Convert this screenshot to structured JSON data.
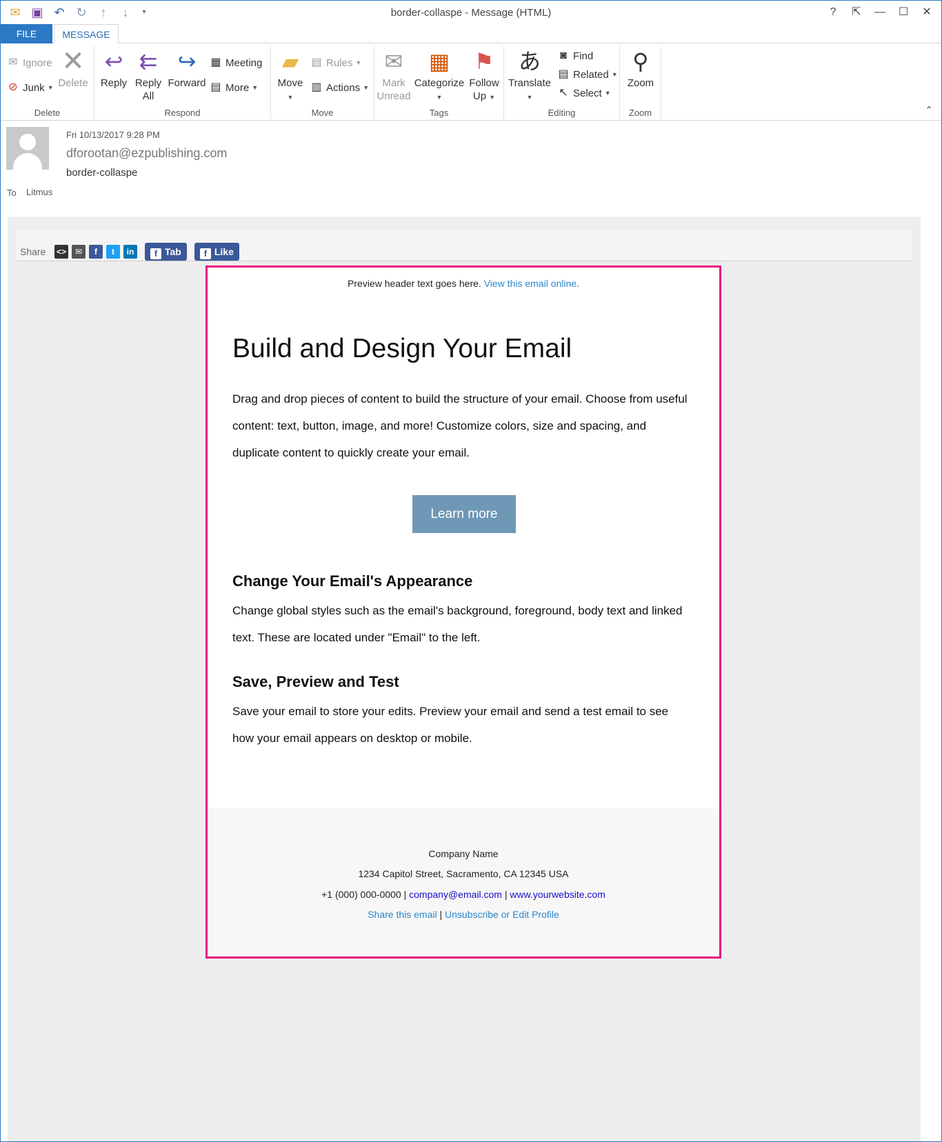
{
  "window": {
    "title": "border-collaspe - Message (HTML)",
    "controls": {
      "help": "?",
      "restore_ribbon": "⇱",
      "minimize": "—",
      "maximize": "☐",
      "close": "✕"
    }
  },
  "tabs": {
    "file": "FILE",
    "message": "MESSAGE"
  },
  "ribbon": {
    "delete": {
      "label": "Delete",
      "ignore": "Ignore",
      "junk": "Junk",
      "delete_btn": "Delete"
    },
    "respond": {
      "label": "Respond",
      "reply": "Reply",
      "reply_all_1": "Reply",
      "reply_all_2": "All",
      "forward": "Forward",
      "meeting": "Meeting",
      "more": "More"
    },
    "move": {
      "label": "Move",
      "move_btn": "Move",
      "rules": "Rules",
      "actions": "Actions"
    },
    "tags": {
      "label": "Tags",
      "mark_1": "Mark",
      "mark_2": "Unread",
      "categorize": "Categorize",
      "follow_1": "Follow",
      "follow_2": "Up"
    },
    "editing": {
      "label": "Editing",
      "translate": "Translate",
      "find": "Find",
      "related": "Related",
      "select": "Select"
    },
    "zoom": {
      "label": "Zoom",
      "zoom_btn": "Zoom"
    }
  },
  "message": {
    "date": "Fri 10/13/2017 9:28 PM",
    "sender": "dforootan@ezpublishing.com",
    "subject": "border-collaspe",
    "to_label": "To",
    "to_value": "Litmus"
  },
  "share": {
    "label": "Share",
    "tab_btn": "Tab",
    "like_btn": "Like"
  },
  "email": {
    "preheader_text": "Preview header text goes here.",
    "preheader_link": "View this email online.",
    "heading": "Build and Design Your Email",
    "intro": "Drag and drop pieces of content to build the structure of your email. Choose from useful content: text, button, image, and more! Customize colors, size and spacing, and duplicate content to quickly create your email.",
    "cta": "Learn more",
    "section1_title": "Change Your Email's Appearance",
    "section1_body": "Change global styles such as the email's background, foreground, body text and linked text. These are located under \"Email\" to the left.",
    "section2_title": "Save, Preview and Test",
    "section2_body": "Save your email to store your edits. Preview your email and send a test email to see how your email appears on desktop or mobile.",
    "footer": {
      "company": "Company Name",
      "address": "1234 Capitol Street, Sacramento, CA 12345 USA",
      "phone": "+1 (000) 000-0000",
      "sep": "|",
      "email": "company@email.com",
      "website": "www.yourwebsite.com",
      "share_link": "Share this email",
      "unsubscribe": "Unsubscribe or Edit Profile"
    }
  }
}
